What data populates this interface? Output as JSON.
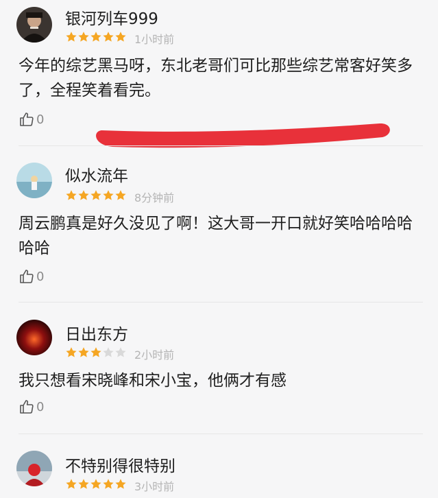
{
  "comments": [
    {
      "username": "银河列车999",
      "rating": 5,
      "time": "1小时前",
      "content": "今年的综艺黑马呀，东北老哥们可比那些综艺常客好笑多了，全程笑着看完。",
      "likes": "0"
    },
    {
      "username": "似水流年",
      "rating": 5,
      "time": "8分钟前",
      "content": "周云鹏真是好久没见了啊！这大哥一开口就好笑哈哈哈哈哈哈",
      "likes": "0"
    },
    {
      "username": "日出东方",
      "rating": 3,
      "time": "2小时前",
      "content": "我只想看宋晓峰和宋小宝，他俩才有感",
      "likes": "0"
    },
    {
      "username": "不特别得很特别",
      "rating": 5,
      "time": "3小时前",
      "content": "",
      "likes": ""
    }
  ],
  "colors": {
    "star_filled": "#f5a623",
    "star_empty": "#d9d9d9",
    "scribble": "#e8313a"
  }
}
